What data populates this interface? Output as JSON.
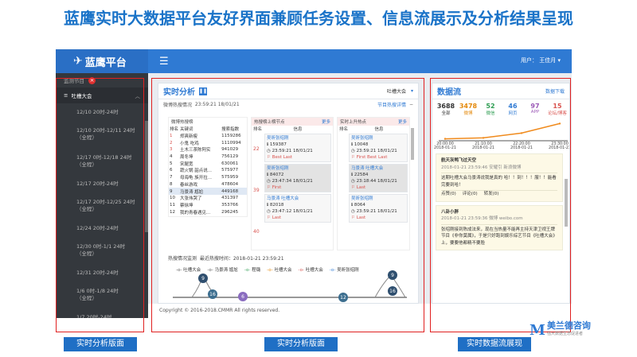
{
  "slide_title": "蓝鹰实时大数据平台友好界面兼顾任务设置、信息流展示及分析结果呈现",
  "app": {
    "logo": "蓝鹰平台",
    "user_label": "用户：",
    "user_name": "王佳月",
    "sidebar": {
      "section": "监测节目",
      "group": "吐槽大会",
      "items": [
        {
          "l1": "12/10 20时-24时",
          "l2": ""
        },
        {
          "l1": "12/10 20时-12/11 24时",
          "l2": "（全程）"
        },
        {
          "l1": "12/17 0时-12/18 24时",
          "l2": "（全程）"
        },
        {
          "l1": "12/17 20时-24时",
          "l2": ""
        },
        {
          "l1": "12/17 20时-12/25 24时",
          "l2": "（全程）"
        },
        {
          "l1": "12/24 20时-24时",
          "l2": ""
        },
        {
          "l1": "12/30 0时-1/1 24时",
          "l2": "（全程）"
        },
        {
          "l1": "12/31 20时-24时",
          "l2": ""
        },
        {
          "l1": "1/6 0时-1/8 24时",
          "l2": "（全程）"
        },
        {
          "l1": "1/7 20时-24时",
          "l2": ""
        }
      ]
    },
    "analysis": {
      "title": "实时分析",
      "program": "吐槽大会",
      "sub_title": "微博热搜情况",
      "sub_time": "23:59:21 18/01/21",
      "sub_link": "节目热搜详情",
      "hot": {
        "header": "微博热搜榜",
        "cols": [
          "排名",
          "关键词",
          "搜索指数"
        ],
        "rows": [
          [
            "1",
            "郑爽新瘦",
            "1159286"
          ],
          [
            "2",
            "小鬼 吃鸡",
            "1110994"
          ],
          [
            "3",
            "土木三茶陈阿实",
            "941029"
          ],
          [
            "4",
            "周冬坤",
            "756129"
          ],
          [
            "5",
            "宋腿宽",
            "630061"
          ],
          [
            "6",
            "蔬火锅 韶点说...",
            "575977"
          ],
          [
            "7",
            "母海龟 族开拉...",
            "575959"
          ],
          [
            "8",
            "春丝游戏",
            "478604"
          ],
          [
            "9",
            "马景涛 尴尬",
            "449168"
          ],
          [
            "10",
            "大张伟哭了",
            "431397"
          ],
          [
            "11",
            "蔡徐坤",
            "353766"
          ],
          [
            "12",
            "我的青春遇见...",
            "296245"
          ]
        ]
      },
      "up": {
        "header": "热搜榜上榜节点",
        "more": "更多",
        "cols": [
          "排名",
          "信息"
        ],
        "ranks": [
          "22",
          "39",
          "40"
        ],
        "cards": [
          {
            "name": "吴昕张绍刚",
            "count": "159387",
            "time": "23:59:21 18/01/21",
            "tag": "Best  Last"
          },
          {
            "name": "吴昕张绍刚",
            "count": "84072",
            "time": "23:47:34 18/01/21",
            "tag": "First"
          },
          {
            "name": "马景涛 吐槽大会",
            "count": "82018",
            "time": "23:47:12 18/01/21",
            "tag": "Last"
          }
        ]
      },
      "rise": {
        "header": "实时上升热点",
        "more": "更多",
        "cols": [
          "排名",
          "信息"
        ],
        "cards": [
          {
            "name": "吴昕张绍刚",
            "count": "10048",
            "time": "23:59:21 18/01/21",
            "tag": "First  Best  Last"
          },
          {
            "name": "马景涛 吐槽大会",
            "count": "22584",
            "time": "23:18:44 18/01/21",
            "tag": "Last"
          },
          {
            "name": "吴昕张绍刚",
            "count": "8064",
            "time": "23:59:21 18/01/21",
            "tag": "Last"
          }
        ]
      },
      "monitor": {
        "title": "热搜情况监测",
        "time_label": "最近热搜时间：2018-01-21 23:59:21",
        "legend": [
          "吐槽大会",
          "马景涛 尴尬",
          "程璐",
          "吐槽大会",
          "吐槽大会",
          "吴昕张绍刚"
        ],
        "bubbles": [
          "9",
          "16",
          "6",
          "12",
          "16",
          "9"
        ]
      }
    },
    "flow": {
      "title": "数据流",
      "download": "数据下载",
      "stats": [
        {
          "value": "3688",
          "label": "全部",
          "color": "#333333"
        },
        {
          "value": "3478",
          "label": "微博",
          "color": "#e4890c"
        },
        {
          "value": "52",
          "label": "微信",
          "color": "#2e9d52"
        },
        {
          "value": "46",
          "label": "网页",
          "color": "#2f7ad3"
        },
        {
          "value": "97",
          "label": "APP",
          "color": "#9b59b6"
        },
        {
          "value": "15",
          "label": "论坛/博客",
          "color": "#d9534f"
        }
      ],
      "chart_data": {
        "type": "line",
        "x": [
          "20:00:00 2018-01-21",
          "21:10:00 2018-01-21",
          "22:20:00 2018-01-21",
          "23:30:00 2018-01-21"
        ],
        "y": [
          10,
          15,
          40,
          90
        ],
        "color": "#f08a1c"
      },
      "posts": [
        {
          "author": "航天灰鸭飞过天空",
          "meta": "2018-01-21 23:59:46  安耀引 新浪微博",
          "body": "这期吐槽大会马景涛说我是真的 哈！！到！！！服！！能看完要到哈！",
          "actions": [
            "点赞(0)",
            "评论(0)",
            "转发(0)"
          ]
        },
        {
          "author": "八卦小胖",
          "meta": "2018-01-21 23:59:36  微博 weibo.com",
          "body": "张绍刚接到陈成法来，现在当热量不能再主持天津卫视王牌节目《非你莫属》，于是只好跑到娱乐综艺节目《吐槽大会》上，要要他都精不要脸"
        }
      ]
    },
    "footer": "Copyright © 2016-2018.CMMR All rights reserved."
  },
  "captions": [
    "实时分析版面",
    "实时分析版面",
    "实时数据流展现"
  ],
  "brand": {
    "m": "M",
    "name": "美兰德咨询",
    "sub": "强大数据生态促进者"
  }
}
